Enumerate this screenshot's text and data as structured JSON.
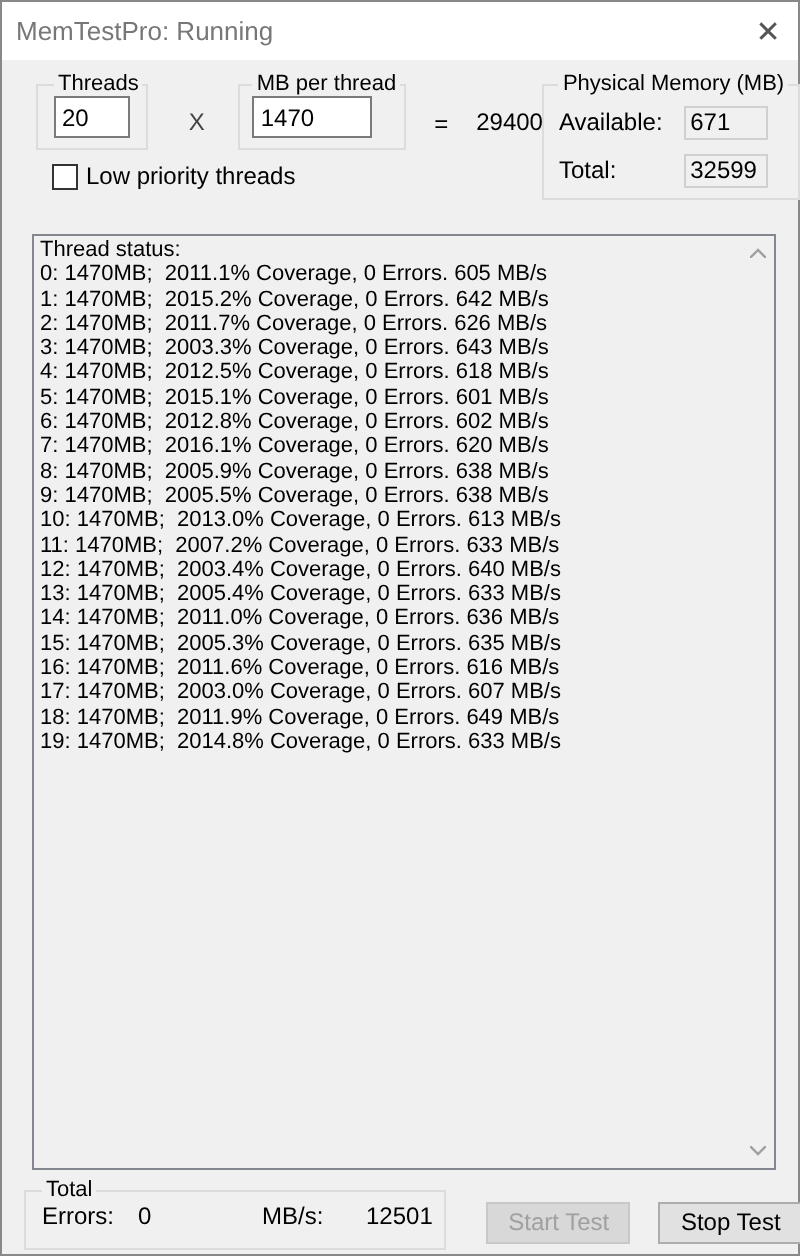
{
  "window": {
    "title": "MemTestPro: Running",
    "close": "✕"
  },
  "threads": {
    "label": "Threads",
    "value": "20"
  },
  "multiply": "X",
  "mb_per_thread": {
    "label": "MB per thread",
    "value": "1470"
  },
  "equals": "=",
  "total_mb": "29400",
  "physical_memory": {
    "title": "Physical Memory (MB)",
    "available_label": "Available:",
    "available": "671",
    "total_label": "Total:",
    "total": "32599"
  },
  "low_priority": {
    "label": "Low priority threads",
    "checked": false
  },
  "status": {
    "heading": "Thread status:",
    "lines": [
      "0: 1470MB;  2011.1% Coverage, 0 Errors. 605 MB/s",
      "1: 1470MB;  2015.2% Coverage, 0 Errors. 642 MB/s",
      "2: 1470MB;  2011.7% Coverage, 0 Errors. 626 MB/s",
      "3: 1470MB;  2003.3% Coverage, 0 Errors. 643 MB/s",
      "4: 1470MB;  2012.5% Coverage, 0 Errors. 618 MB/s",
      "5: 1470MB;  2015.1% Coverage, 0 Errors. 601 MB/s",
      "6: 1470MB;  2012.8% Coverage, 0 Errors. 602 MB/s",
      "7: 1470MB;  2016.1% Coverage, 0 Errors. 620 MB/s",
      "8: 1470MB;  2005.9% Coverage, 0 Errors. 638 MB/s",
      "9: 1470MB;  2005.5% Coverage, 0 Errors. 638 MB/s",
      "10: 1470MB;  2013.0% Coverage, 0 Errors. 613 MB/s",
      "11: 1470MB;  2007.2% Coverage, 0 Errors. 633 MB/s",
      "12: 1470MB;  2003.4% Coverage, 0 Errors. 640 MB/s",
      "13: 1470MB;  2005.4% Coverage, 0 Errors. 633 MB/s",
      "14: 1470MB;  2011.0% Coverage, 0 Errors. 636 MB/s",
      "15: 1470MB;  2005.3% Coverage, 0 Errors. 635 MB/s",
      "16: 1470MB;  2011.6% Coverage, 0 Errors. 616 MB/s",
      "17: 1470MB;  2003.0% Coverage, 0 Errors. 607 MB/s",
      "18: 1470MB;  2011.9% Coverage, 0 Errors. 649 MB/s",
      "19: 1470MB;  2014.8% Coverage, 0 Errors. 633 MB/s"
    ]
  },
  "total": {
    "title": "Total",
    "errors_label": "Errors:",
    "errors": "0",
    "rate_label": "MB/s:",
    "rate": "12501"
  },
  "buttons": [
    {
      "label": "Start Test",
      "disabled": true
    },
    {
      "label": "Stop Test",
      "disabled": false
    }
  ]
}
